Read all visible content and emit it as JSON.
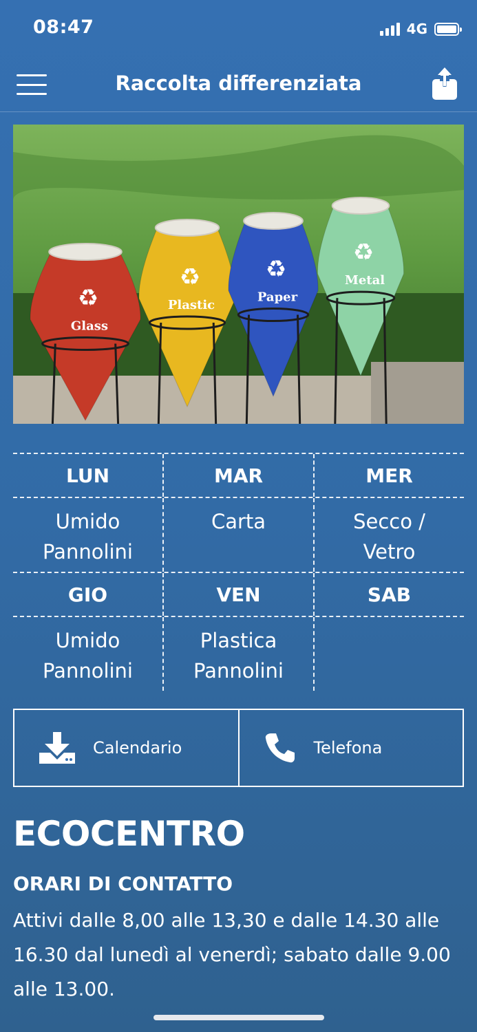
{
  "status_bar": {
    "time": "08:47",
    "network": "4G"
  },
  "nav": {
    "title": "Raccolta differenziata"
  },
  "hero": {
    "bin_labels": [
      "Glass",
      "Plastic",
      "Paper",
      "Metal"
    ],
    "bin_colors": [
      "#c53a28",
      "#e8b820",
      "#2f55bf",
      "#8ed3a6"
    ]
  },
  "schedule": {
    "rows": [
      {
        "days": [
          "LUN",
          "MAR",
          "MER"
        ],
        "waste": [
          [
            "Umido",
            "Pannolini"
          ],
          [
            "Carta"
          ],
          [
            "Secco /",
            "Vetro"
          ]
        ]
      },
      {
        "days": [
          "GIO",
          "VEN",
          "SAB"
        ],
        "waste": [
          [
            "Umido",
            "Pannolini"
          ],
          [
            "Plastica",
            "Pannolini"
          ],
          []
        ]
      }
    ]
  },
  "actions": {
    "calendar_label": "Calendario",
    "phone_label": "Telefona"
  },
  "ecocentro": {
    "title": "ECOCENTRO",
    "subtitle": "ORARI DI CONTATTO",
    "text": "Attivi dalle 8,00 alle 13,30 e dalle 14.30 alle 16.30 dal lunedì al venerdì; sabato dalle 9.00 alle 13.00."
  },
  "colors": {
    "background": "#3570b2",
    "text": "#ffffff"
  }
}
